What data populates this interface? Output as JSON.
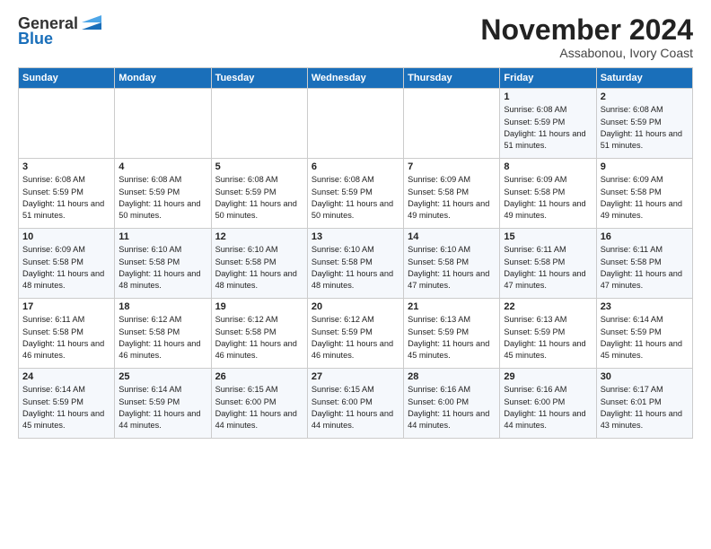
{
  "header": {
    "logo_general": "General",
    "logo_blue": "Blue",
    "title": "November 2024",
    "subtitle": "Assabonou, Ivory Coast"
  },
  "days_of_week": [
    "Sunday",
    "Monday",
    "Tuesday",
    "Wednesday",
    "Thursday",
    "Friday",
    "Saturday"
  ],
  "weeks": [
    [
      {
        "day": "",
        "sunrise": "",
        "sunset": "",
        "daylight": "",
        "empty": true
      },
      {
        "day": "",
        "sunrise": "",
        "sunset": "",
        "daylight": "",
        "empty": true
      },
      {
        "day": "",
        "sunrise": "",
        "sunset": "",
        "daylight": "",
        "empty": true
      },
      {
        "day": "",
        "sunrise": "",
        "sunset": "",
        "daylight": "",
        "empty": true
      },
      {
        "day": "",
        "sunrise": "",
        "sunset": "",
        "daylight": "",
        "empty": true
      },
      {
        "day": "1",
        "sunrise": "Sunrise: 6:08 AM",
        "sunset": "Sunset: 5:59 PM",
        "daylight": "Daylight: 11 hours and 51 minutes.",
        "empty": false
      },
      {
        "day": "2",
        "sunrise": "Sunrise: 6:08 AM",
        "sunset": "Sunset: 5:59 PM",
        "daylight": "Daylight: 11 hours and 51 minutes.",
        "empty": false
      }
    ],
    [
      {
        "day": "3",
        "sunrise": "Sunrise: 6:08 AM",
        "sunset": "Sunset: 5:59 PM",
        "daylight": "Daylight: 11 hours and 51 minutes.",
        "empty": false
      },
      {
        "day": "4",
        "sunrise": "Sunrise: 6:08 AM",
        "sunset": "Sunset: 5:59 PM",
        "daylight": "Daylight: 11 hours and 50 minutes.",
        "empty": false
      },
      {
        "day": "5",
        "sunrise": "Sunrise: 6:08 AM",
        "sunset": "Sunset: 5:59 PM",
        "daylight": "Daylight: 11 hours and 50 minutes.",
        "empty": false
      },
      {
        "day": "6",
        "sunrise": "Sunrise: 6:08 AM",
        "sunset": "Sunset: 5:59 PM",
        "daylight": "Daylight: 11 hours and 50 minutes.",
        "empty": false
      },
      {
        "day": "7",
        "sunrise": "Sunrise: 6:09 AM",
        "sunset": "Sunset: 5:58 PM",
        "daylight": "Daylight: 11 hours and 49 minutes.",
        "empty": false
      },
      {
        "day": "8",
        "sunrise": "Sunrise: 6:09 AM",
        "sunset": "Sunset: 5:58 PM",
        "daylight": "Daylight: 11 hours and 49 minutes.",
        "empty": false
      },
      {
        "day": "9",
        "sunrise": "Sunrise: 6:09 AM",
        "sunset": "Sunset: 5:58 PM",
        "daylight": "Daylight: 11 hours and 49 minutes.",
        "empty": false
      }
    ],
    [
      {
        "day": "10",
        "sunrise": "Sunrise: 6:09 AM",
        "sunset": "Sunset: 5:58 PM",
        "daylight": "Daylight: 11 hours and 48 minutes.",
        "empty": false
      },
      {
        "day": "11",
        "sunrise": "Sunrise: 6:10 AM",
        "sunset": "Sunset: 5:58 PM",
        "daylight": "Daylight: 11 hours and 48 minutes.",
        "empty": false
      },
      {
        "day": "12",
        "sunrise": "Sunrise: 6:10 AM",
        "sunset": "Sunset: 5:58 PM",
        "daylight": "Daylight: 11 hours and 48 minutes.",
        "empty": false
      },
      {
        "day": "13",
        "sunrise": "Sunrise: 6:10 AM",
        "sunset": "Sunset: 5:58 PM",
        "daylight": "Daylight: 11 hours and 48 minutes.",
        "empty": false
      },
      {
        "day": "14",
        "sunrise": "Sunrise: 6:10 AM",
        "sunset": "Sunset: 5:58 PM",
        "daylight": "Daylight: 11 hours and 47 minutes.",
        "empty": false
      },
      {
        "day": "15",
        "sunrise": "Sunrise: 6:11 AM",
        "sunset": "Sunset: 5:58 PM",
        "daylight": "Daylight: 11 hours and 47 minutes.",
        "empty": false
      },
      {
        "day": "16",
        "sunrise": "Sunrise: 6:11 AM",
        "sunset": "Sunset: 5:58 PM",
        "daylight": "Daylight: 11 hours and 47 minutes.",
        "empty": false
      }
    ],
    [
      {
        "day": "17",
        "sunrise": "Sunrise: 6:11 AM",
        "sunset": "Sunset: 5:58 PM",
        "daylight": "Daylight: 11 hours and 46 minutes.",
        "empty": false
      },
      {
        "day": "18",
        "sunrise": "Sunrise: 6:12 AM",
        "sunset": "Sunset: 5:58 PM",
        "daylight": "Daylight: 11 hours and 46 minutes.",
        "empty": false
      },
      {
        "day": "19",
        "sunrise": "Sunrise: 6:12 AM",
        "sunset": "Sunset: 5:58 PM",
        "daylight": "Daylight: 11 hours and 46 minutes.",
        "empty": false
      },
      {
        "day": "20",
        "sunrise": "Sunrise: 6:12 AM",
        "sunset": "Sunset: 5:59 PM",
        "daylight": "Daylight: 11 hours and 46 minutes.",
        "empty": false
      },
      {
        "day": "21",
        "sunrise": "Sunrise: 6:13 AM",
        "sunset": "Sunset: 5:59 PM",
        "daylight": "Daylight: 11 hours and 45 minutes.",
        "empty": false
      },
      {
        "day": "22",
        "sunrise": "Sunrise: 6:13 AM",
        "sunset": "Sunset: 5:59 PM",
        "daylight": "Daylight: 11 hours and 45 minutes.",
        "empty": false
      },
      {
        "day": "23",
        "sunrise": "Sunrise: 6:14 AM",
        "sunset": "Sunset: 5:59 PM",
        "daylight": "Daylight: 11 hours and 45 minutes.",
        "empty": false
      }
    ],
    [
      {
        "day": "24",
        "sunrise": "Sunrise: 6:14 AM",
        "sunset": "Sunset: 5:59 PM",
        "daylight": "Daylight: 11 hours and 45 minutes.",
        "empty": false
      },
      {
        "day": "25",
        "sunrise": "Sunrise: 6:14 AM",
        "sunset": "Sunset: 5:59 PM",
        "daylight": "Daylight: 11 hours and 44 minutes.",
        "empty": false
      },
      {
        "day": "26",
        "sunrise": "Sunrise: 6:15 AM",
        "sunset": "Sunset: 6:00 PM",
        "daylight": "Daylight: 11 hours and 44 minutes.",
        "empty": false
      },
      {
        "day": "27",
        "sunrise": "Sunrise: 6:15 AM",
        "sunset": "Sunset: 6:00 PM",
        "daylight": "Daylight: 11 hours and 44 minutes.",
        "empty": false
      },
      {
        "day": "28",
        "sunrise": "Sunrise: 6:16 AM",
        "sunset": "Sunset: 6:00 PM",
        "daylight": "Daylight: 11 hours and 44 minutes.",
        "empty": false
      },
      {
        "day": "29",
        "sunrise": "Sunrise: 6:16 AM",
        "sunset": "Sunset: 6:00 PM",
        "daylight": "Daylight: 11 hours and 44 minutes.",
        "empty": false
      },
      {
        "day": "30",
        "sunrise": "Sunrise: 6:17 AM",
        "sunset": "Sunset: 6:01 PM",
        "daylight": "Daylight: 11 hours and 43 minutes.",
        "empty": false
      }
    ]
  ]
}
